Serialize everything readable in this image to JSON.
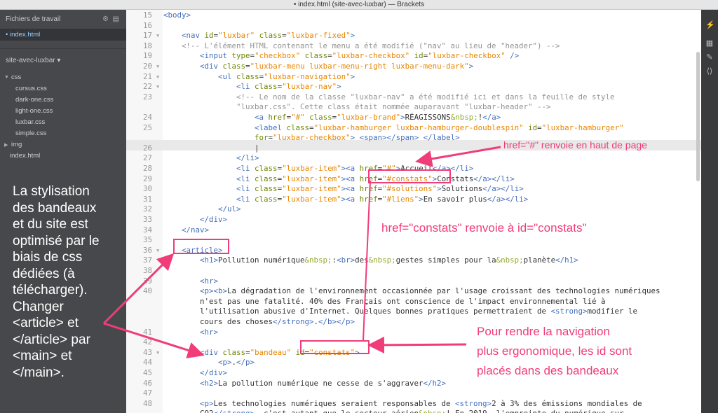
{
  "window": {
    "title": "• index.html (site-avec-luxbar) — Brackets"
  },
  "sidebar": {
    "working_files_title": "Fichiers de travail",
    "working_files": [
      "index.html"
    ],
    "project_name": "site-avec-luxbar ▾",
    "tree": [
      {
        "label": "css",
        "kind": "folder-open"
      },
      {
        "label": "cursus.css",
        "kind": "file"
      },
      {
        "label": "dark-one.css",
        "kind": "file"
      },
      {
        "label": "light-one.css",
        "kind": "file"
      },
      {
        "label": "luxbar.css",
        "kind": "file"
      },
      {
        "label": "simple.css",
        "kind": "file"
      },
      {
        "label": "img",
        "kind": "folder-closed"
      },
      {
        "label": "index.html",
        "kind": "file"
      }
    ],
    "overlay_text": "La stylisation des bandeaux et du site est optimisé par le biais de css dédiées (à télécharger). Changer <article> et </article> par <main> et </main>."
  },
  "editor": {
    "lines": [
      {
        "n": "15",
        "fold": "",
        "html": "<span class=\"t\">&lt;body&gt;</span>"
      },
      {
        "n": "16",
        "fold": "",
        "html": ""
      },
      {
        "n": "17",
        "fold": "▼",
        "html": "    <span class=\"t\">&lt;nav</span> <span class=\"a\">id</span>=<span class=\"s\">\"luxbar\"</span> <span class=\"a\">class</span>=<span class=\"s\">\"luxbar-fixed\"</span><span class=\"t\">&gt;</span>"
      },
      {
        "n": "18",
        "fold": "",
        "html": "    <span class=\"c\">&lt;!-- L'élément HTML contenant le menu a été modifié (\"nav\" au lieu de \"header\") --&gt;</span>"
      },
      {
        "n": "19",
        "fold": "",
        "html": "        <span class=\"t\">&lt;input</span> <span class=\"a\">type</span>=<span class=\"s\">\"checkbox\"</span> <span class=\"a\">class</span>=<span class=\"s\">\"luxbar-checkbox\"</span> <span class=\"a\">id</span>=<span class=\"s\">\"luxbar-checkbox\"</span> <span class=\"t\">/&gt;</span>"
      },
      {
        "n": "20",
        "fold": "▼",
        "html": "        <span class=\"t\">&lt;div</span> <span class=\"a\">class</span>=<span class=\"s\">\"luxbar-menu luxbar-menu-right luxbar-menu-dark\"</span><span class=\"t\">&gt;</span>"
      },
      {
        "n": "21",
        "fold": "▼",
        "html": "            <span class=\"t\">&lt;ul</span> <span class=\"a\">class</span>=<span class=\"s\">\"luxbar-navigation\"</span><span class=\"t\">&gt;</span>"
      },
      {
        "n": "22",
        "fold": "▼",
        "html": "                <span class=\"t\">&lt;li</span> <span class=\"a\">class</span>=<span class=\"s\">\"luxbar-nav\"</span><span class=\"t\">&gt;</span>"
      },
      {
        "n": "23",
        "fold": "",
        "html": "                <span class=\"c\">&lt;!-- Le nom de la classe \"luxbar-nav\" a été modifié ici et dans la feuille de style</span>"
      },
      {
        "n": "",
        "fold": "",
        "html": "                <span class=\"c\">\"luxbar.css\". Cette class était nommée auparavant \"luxbar-header\" --&gt;</span>"
      },
      {
        "n": "24",
        "fold": "",
        "html": "                    <span class=\"t\">&lt;a</span> <span class=\"a\">href</span>=<span class=\"s\">\"#\"</span> <span class=\"a\">class</span>=<span class=\"s\">\"luxbar-brand\"</span><span class=\"t\">&gt;</span>RÉAGISSONS<span class=\"e\">&amp;nbsp;</span>!<span class=\"t\">&lt;/a&gt;</span>"
      },
      {
        "n": "25",
        "fold": "",
        "html": "                    <span class=\"t\">&lt;label</span> <span class=\"a\">class</span>=<span class=\"s\">\"luxbar-hamburger luxbar-hamburger-doublespin\"</span> <span class=\"a\">id</span>=<span class=\"s\">\"luxbar-hamburger\"</span>"
      },
      {
        "n": "",
        "fold": "",
        "html": "                    <span class=\"a\">for</span>=<span class=\"s\">\"luxbar-checkbox\"</span><span class=\"t\">&gt;</span> <span class=\"t\">&lt;span&gt;&lt;/span&gt;</span> <span class=\"t\">&lt;/label&gt;</span>"
      },
      {
        "n": "26",
        "fold": "",
        "html": "                    |"
      },
      {
        "n": "27",
        "fold": "",
        "html": "                <span class=\"t\">&lt;/li&gt;</span>"
      },
      {
        "n": "28",
        "fold": "",
        "html": "                <span class=\"t\">&lt;li</span> <span class=\"a\">class</span>=<span class=\"s\">\"luxbar-item\"</span><span class=\"t\">&gt;&lt;a</span> <span class=\"a\">href</span>=<span class=\"s\">\"#\"</span><span class=\"t\">&gt;</span>Accueil<span class=\"t\">&lt;/a&gt;&lt;/li&gt;</span>"
      },
      {
        "n": "29",
        "fold": "",
        "html": "                <span class=\"t\">&lt;li</span> <span class=\"a\">class</span>=<span class=\"s\">\"luxbar-item\"</span><span class=\"t\">&gt;&lt;a</span> <span class=\"a\">href</span>=<span class=\"s\">\"#constats\"</span><span class=\"t\">&gt;</span>Constats<span class=\"t\">&lt;/a&gt;&lt;/li&gt;</span>"
      },
      {
        "n": "30",
        "fold": "",
        "html": "                <span class=\"t\">&lt;li</span> <span class=\"a\">class</span>=<span class=\"s\">\"luxbar-item\"</span><span class=\"t\">&gt;&lt;a</span> <span class=\"a\">href</span>=<span class=\"s\">\"#solutions\"</span><span class=\"t\">&gt;</span>Solutions<span class=\"t\">&lt;/a&gt;&lt;/li&gt;</span>"
      },
      {
        "n": "31",
        "fold": "",
        "html": "                <span class=\"t\">&lt;li</span> <span class=\"a\">class</span>=<span class=\"s\">\"luxbar-item\"</span><span class=\"t\">&gt;&lt;a</span> <span class=\"a\">href</span>=<span class=\"s\">\"#liens\"</span><span class=\"t\">&gt;</span>En savoir plus<span class=\"t\">&lt;/a&gt;&lt;/li&gt;</span>"
      },
      {
        "n": "32",
        "fold": "",
        "html": "            <span class=\"t\">&lt;/ul&gt;</span>"
      },
      {
        "n": "33",
        "fold": "",
        "html": "        <span class=\"t\">&lt;/div&gt;</span>"
      },
      {
        "n": "34",
        "fold": "",
        "html": "    <span class=\"t\">&lt;/nav&gt;</span>"
      },
      {
        "n": "35",
        "fold": "",
        "html": ""
      },
      {
        "n": "36",
        "fold": "▼",
        "html": "    <span class=\"t\">&lt;article&gt;</span>"
      },
      {
        "n": "37",
        "fold": "",
        "html": "        <span class=\"t\">&lt;h1&gt;</span>Pollution numérique<span class=\"e\">&amp;nbsp;</span>:<span class=\"t\">&lt;br&gt;</span>des<span class=\"e\">&amp;nbsp;</span>gestes simples pour la<span class=\"e\">&amp;nbsp;</span>planète<span class=\"t\">&lt;/h1&gt;</span>"
      },
      {
        "n": "38",
        "fold": "",
        "html": ""
      },
      {
        "n": "39",
        "fold": "",
        "html": "        <span class=\"t\">&lt;hr&gt;</span>"
      },
      {
        "n": "40",
        "fold": "",
        "html": "        <span class=\"t\">&lt;p&gt;&lt;b&gt;</span>La dégradation de l'environnement occasionnée par l'usage croissant des technologies numériques"
      },
      {
        "n": "",
        "fold": "",
        "html": "        n'est pas une fatalité. 40% des Français ont conscience de l'impact environnemental lié à"
      },
      {
        "n": "",
        "fold": "",
        "html": "        l'utilisation abusive d'Internet. Quelques bonnes pratiques permettraient de <span class=\"t\">&lt;strong&gt;</span>modifier le"
      },
      {
        "n": "",
        "fold": "",
        "html": "        cours des choses<span class=\"t\">&lt;/strong&gt;</span>.<span class=\"t\">&lt;/b&gt;&lt;/p&gt;</span>"
      },
      {
        "n": "41",
        "fold": "",
        "html": "        <span class=\"t\">&lt;hr&gt;</span>"
      },
      {
        "n": "42",
        "fold": "",
        "html": ""
      },
      {
        "n": "43",
        "fold": "▼",
        "html": "        <span class=\"t\">&lt;div</span> <span class=\"a\">class</span>=<span class=\"s\">\"bandeau\"</span> <span class=\"a\">id</span>=<span class=\"s\">\"constats\"</span><span class=\"t\">&gt;</span>"
      },
      {
        "n": "44",
        "fold": "",
        "html": "            <span class=\"t\">&lt;p&gt;</span>.<span class=\"t\">&lt;/p&gt;</span>"
      },
      {
        "n": "45",
        "fold": "",
        "html": "        <span class=\"t\">&lt;/div&gt;</span>"
      },
      {
        "n": "46",
        "fold": "",
        "html": "        <span class=\"t\">&lt;h2&gt;</span>La pollution numérique ne cesse de s'aggraver<span class=\"t\">&lt;/h2&gt;</span>"
      },
      {
        "n": "47",
        "fold": "",
        "html": ""
      },
      {
        "n": "48",
        "fold": "",
        "html": "        <span class=\"t\">&lt;p&gt;</span>Les technologies numériques seraient responsables de <span class=\"t\">&lt;strong&gt;</span>2 à 3% des émissions mondiales de"
      },
      {
        "n": "",
        "fold": "",
        "html": "        CO2<span class=\"t\">&lt;/strong&gt;</span>, c'est autant que le secteur aérien<span class=\"e\">&amp;nbsp;</span>! En 2019, l'empreinte du numérique sur"
      }
    ]
  },
  "annotations": {
    "href_hash": "href=\"#\" renvoie en haut de page",
    "href_constats": "href=\"constats\" renvoie à id=\"constats\"",
    "ergonomic": [
      "Pour rendre la navigation",
      "plus ergonomique, les id sont",
      "placés dans des bandeaux"
    ]
  },
  "toolbar_icons": [
    "live-preview-icon",
    "extension-manager-icon",
    "tools-icon",
    "code-icon"
  ],
  "colors": {
    "annotation": "#f03c78",
    "tag": "#446fbd",
    "attr": "#6d8600",
    "string": "#e88501",
    "comment": "#949494"
  }
}
